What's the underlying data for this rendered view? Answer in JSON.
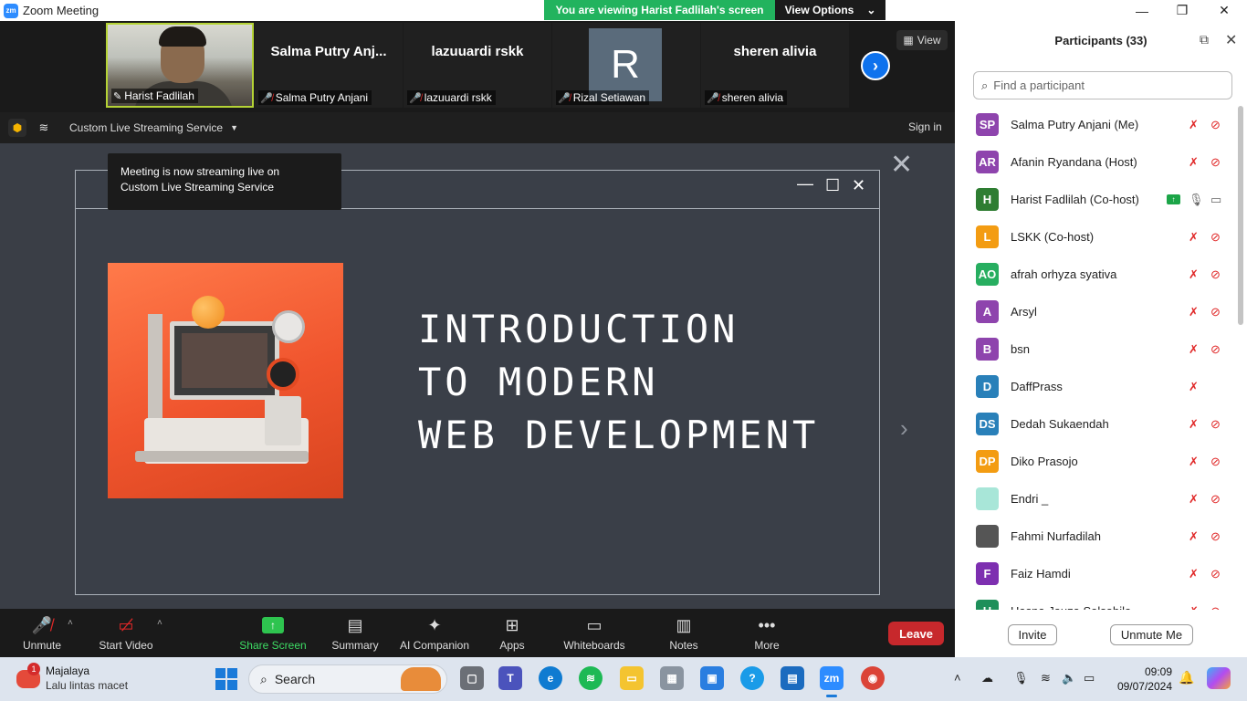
{
  "window": {
    "title": "Zoom Meeting",
    "logo_text": "zm"
  },
  "banner": {
    "text": "You are viewing Harist Fadlilah's screen",
    "button": "View Options"
  },
  "thumbnails": [
    {
      "name": "",
      "label": "Harist Fadlilah",
      "video": true
    },
    {
      "name": "Salma Putry Anj...",
      "label": "Salma Putry Anjani"
    },
    {
      "name": "lazuuardi rskk",
      "label": "lazuuardi rskk"
    },
    {
      "name": "R",
      "label": "Rizal Setiawan",
      "avatar": true
    },
    {
      "name": "sheren alivia",
      "label": "sheren alivia"
    }
  ],
  "view_button": "View",
  "info": {
    "live_service": "Custom Live Streaming Service",
    "sign_in": "Sign in"
  },
  "tooltip": {
    "line1": "Meeting is now streaming live on",
    "line2": "Custom Live Streaming Service"
  },
  "slide": {
    "title": "INTRODUCTION\nTO MODERN\nWEB DEVELOPMENT"
  },
  "toolbar": {
    "unmute": "Unmute",
    "start_video": "Start Video",
    "share_screen": "Share Screen",
    "summary": "Summary",
    "ai_companion": "AI Companion",
    "apps": "Apps",
    "whiteboards": "Whiteboards",
    "notes": "Notes",
    "more": "More",
    "leave": "Leave"
  },
  "participants": {
    "title": "Participants (33)",
    "search_placeholder": "Find a participant",
    "list": [
      {
        "initials": "SP",
        "name": "Salma Putry Anjani (Me)",
        "color": "#8e44ad",
        "mic": "off",
        "cam": "off"
      },
      {
        "initials": "AR",
        "name": "Afanin Ryandana (Host)",
        "color": "#8e44ad",
        "mic": "off",
        "cam": "off"
      },
      {
        "initials": "H",
        "name": "Harist Fadlilah (Co-host)",
        "color": "#2e7d32",
        "mic": "on",
        "cam": "on",
        "sharing": true
      },
      {
        "initials": "L",
        "name": "LSKK (Co-host)",
        "color": "#f39c12",
        "mic": "off",
        "cam": "off"
      },
      {
        "initials": "AO",
        "name": "afrah orhyza syativa",
        "color": "#27ae60",
        "mic": "off",
        "cam": "off"
      },
      {
        "initials": "A",
        "name": "Arsyl",
        "color": "#8e44ad",
        "mic": "off",
        "cam": "off"
      },
      {
        "initials": "B",
        "name": "bsn",
        "color": "#8e44ad",
        "mic": "off",
        "cam": "off"
      },
      {
        "initials": "D",
        "name": "DaffPrass",
        "color": "#2980b9",
        "mic": "off",
        "cam": "none"
      },
      {
        "initials": "DS",
        "name": "Dedah Sukaendah",
        "color": "#2980b9",
        "mic": "off",
        "cam": "off"
      },
      {
        "initials": "DP",
        "name": "Diko Prasojo",
        "color": "#f39c12",
        "mic": "off",
        "cam": "off"
      },
      {
        "initials": "",
        "name": "Endri _",
        "color": "#a8e6d8",
        "mic": "off",
        "cam": "off"
      },
      {
        "initials": "",
        "name": "Fahmi Nurfadilah",
        "color": "#555555",
        "mic": "off",
        "cam": "off"
      },
      {
        "initials": "F",
        "name": "Faiz Hamdi",
        "color": "#7d2fb0",
        "mic": "off",
        "cam": "off"
      },
      {
        "initials": "H",
        "name": "Hasna Jauza Salsabila",
        "color": "#1e8f5a",
        "mic": "off",
        "cam": "off"
      }
    ],
    "invite": "Invite",
    "unmute_me": "Unmute Me"
  },
  "taskbar": {
    "weather_city": "Majalaya",
    "weather_text": "Lalu lintas macet",
    "weather_badge": "1",
    "search": "Search",
    "time": "09:09",
    "date": "09/07/2024"
  }
}
